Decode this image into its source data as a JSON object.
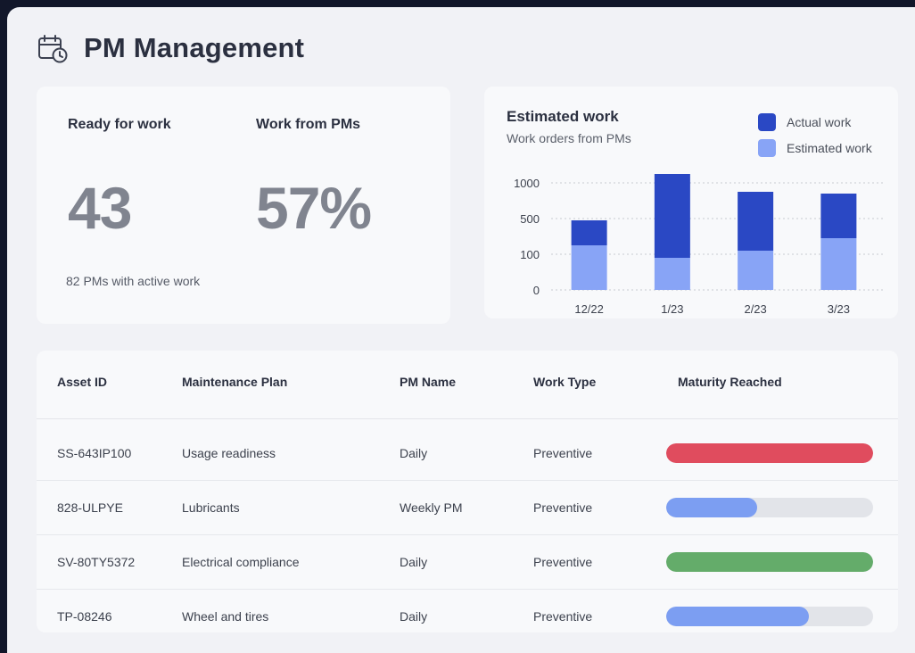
{
  "page": {
    "title": "PM Management",
    "icon": "calendar-clock-icon"
  },
  "kpis": {
    "ready": {
      "label": "Ready for work",
      "value": "43",
      "sub": "82 PMs with active work"
    },
    "pms": {
      "label": "Work from PMs",
      "value": "57%"
    }
  },
  "chart": {
    "title": "Estimated work",
    "subtitle": "Work orders from PMs",
    "legend": [
      {
        "label": "Actual work",
        "color": "#2a48c4"
      },
      {
        "label": "Estimated work",
        "color": "#88a4f6"
      }
    ]
  },
  "chart_data": {
    "type": "bar",
    "stacked": true,
    "categories": [
      "12/22",
      "1/23",
      "2/23",
      "3/23"
    ],
    "y_ticks": [
      "1000",
      "500",
      "100",
      "0"
    ],
    "series": [
      {
        "name": "Estimated work",
        "color": "#88a4f6",
        "values": [
          1.25,
          0.9,
          1.1,
          1.45
        ]
      },
      {
        "name": "Actual work",
        "color": "#2a48c4",
        "values": [
          0.7,
          2.35,
          1.65,
          1.25
        ]
      }
    ],
    "scale_note": "ordinal tick scale: index units 0..3 map to labels 0,100,500,1000",
    "grid": true,
    "legend_position": "top-right"
  },
  "table": {
    "columns": [
      "Asset ID",
      "Maintenance Plan",
      "PM Name",
      "Work Type",
      "Maturity Reached"
    ],
    "rows": [
      {
        "asset": "SS-643IP100",
        "plan": "Usage readiness",
        "pm": "Daily",
        "type": "Preventive",
        "maturity": 1.0,
        "color": "#e04c5e"
      },
      {
        "asset": "828-ULPYE",
        "plan": "Lubricants",
        "pm": "Weekly PM",
        "type": "Preventive",
        "maturity": 0.44,
        "color": "#7c9ef2"
      },
      {
        "asset": "SV-80TY5372",
        "plan": "Electrical compliance",
        "pm": "Daily",
        "type": "Preventive",
        "maturity": 1.0,
        "color": "#64ac6a"
      },
      {
        "asset": "TP-08246",
        "plan": "Wheel and tires",
        "pm": "Daily",
        "type": "Preventive",
        "maturity": 0.69,
        "color": "#7c9ef2"
      }
    ]
  }
}
